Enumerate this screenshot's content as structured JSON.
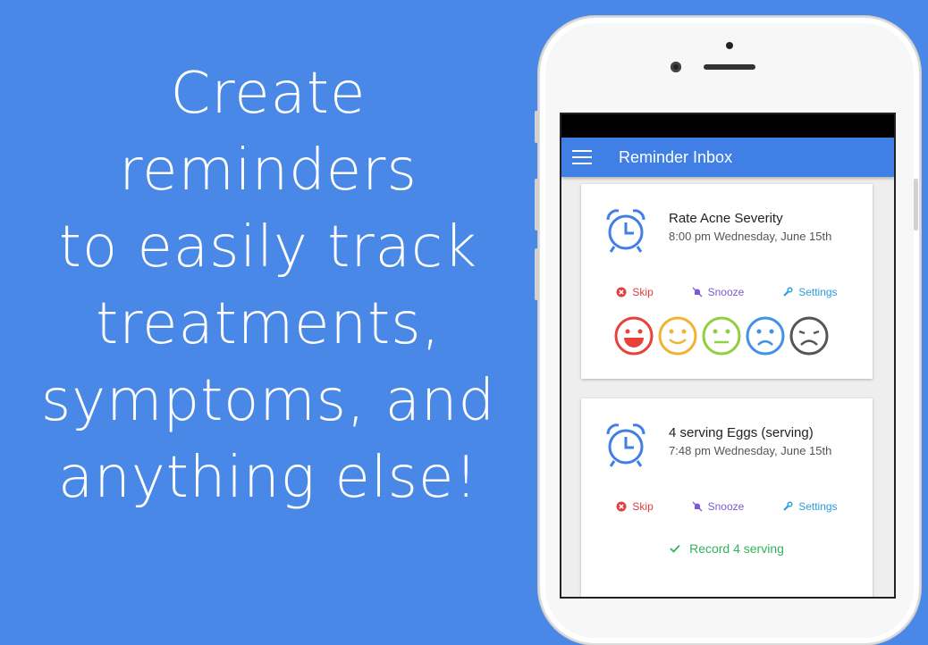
{
  "promo": {
    "lines": [
      "Create",
      "reminders",
      "to easily track",
      "treatments,",
      "symptoms, and",
      "anything else!"
    ]
  },
  "app": {
    "title": "Reminder Inbox",
    "menu_icon": "hamburger-menu-icon"
  },
  "reminders": [
    {
      "title": "Rate Acne Severity",
      "time": "8:00 pm Wednesday, June 15th",
      "actions": {
        "skip": "Skip",
        "snooze": "Snooze",
        "settings": "Settings"
      },
      "ratings": [
        "very-happy-face-icon",
        "happy-face-icon",
        "neutral-face-icon",
        "sad-face-icon",
        "very-sad-face-icon"
      ]
    },
    {
      "title": "4 serving Eggs (serving)",
      "time": "7:48 pm Wednesday, June 15th",
      "actions": {
        "skip": "Skip",
        "snooze": "Snooze",
        "settings": "Settings"
      },
      "record_label": "Record 4 serving"
    }
  ],
  "colors": {
    "background": "#4a88e8",
    "appbar": "#3f7fe6",
    "skip": "#e04040",
    "snooze": "#7b5ad6",
    "settings": "#2a9be0",
    "record": "#31b35a",
    "face_red": "#e8413a",
    "face_orange": "#f2b236",
    "face_green": "#92cf3f",
    "face_blue": "#3f93e6",
    "face_dark": "#555555"
  }
}
